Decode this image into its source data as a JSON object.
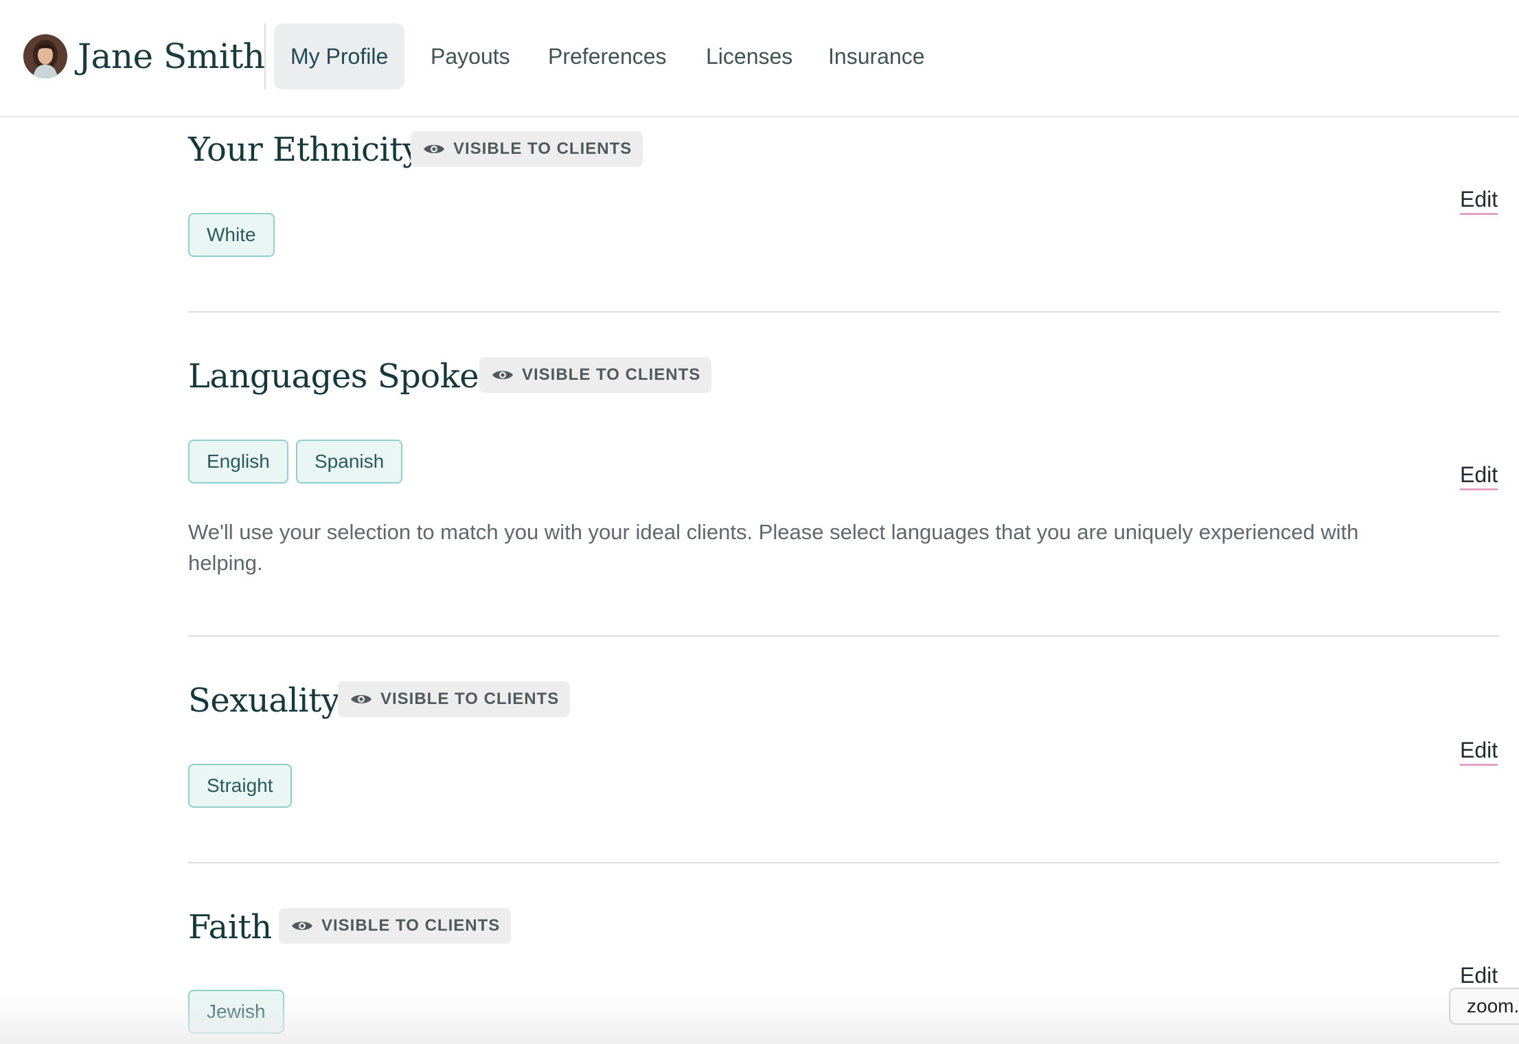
{
  "user": {
    "name": "Jane Smith"
  },
  "nav": {
    "tabs": [
      {
        "label": "My Profile",
        "active": true
      },
      {
        "label": "Payouts",
        "active": false
      },
      {
        "label": "Preferences",
        "active": false
      },
      {
        "label": "Licenses",
        "active": false
      },
      {
        "label": "Insurance",
        "active": false
      }
    ]
  },
  "sections": [
    {
      "title": "Your Ethnicity",
      "badge": "VISIBLE TO CLIENTS",
      "tags": [
        "White"
      ],
      "edit_label": "Edit"
    },
    {
      "title": "Languages Spoken",
      "badge": "VISIBLE TO CLIENTS",
      "tags": [
        "English",
        "Spanish"
      ],
      "helper_text": "We'll use your selection to match you with your ideal clients. Please select languages that you are uniquely experienced with helping.",
      "edit_label": "Edit"
    },
    {
      "title": "Sexuality",
      "badge": "VISIBLE TO CLIENTS",
      "tags": [
        "Straight"
      ],
      "edit_label": "Edit"
    },
    {
      "title": "Faith",
      "badge": "VISIBLE TO CLIENTS",
      "tags": [
        "Jewish"
      ],
      "edit_label": "Edit"
    }
  ],
  "icons": {
    "badge_icon": "eye-icon"
  },
  "colors": {
    "heading": "#15383d",
    "tag_background": "#e9f6f4",
    "tag_border": "#8fd0c8",
    "badge_background": "#ededed",
    "edit_underline": "#e3a3c4",
    "active_tab_background": "#ebedee"
  },
  "tooltip": {
    "text": "zoom."
  }
}
